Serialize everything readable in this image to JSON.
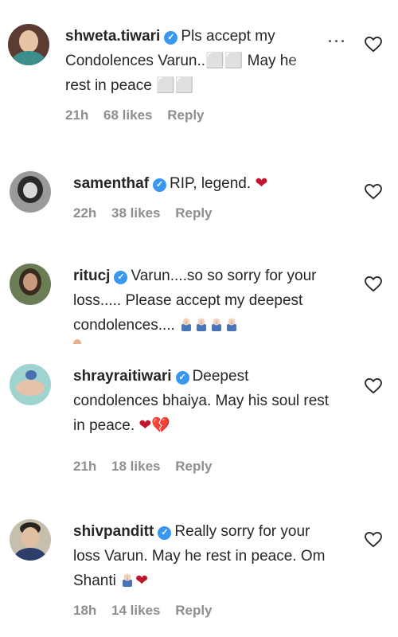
{
  "comments": [
    {
      "username": "shweta.tiwari",
      "text": "Pls accept my Condolences Varun..⬜⬜ May he rest in peace ⬜⬜",
      "time": "21h",
      "likes": "68 likes",
      "reply": "Reply",
      "more": "···"
    },
    {
      "username": "samenthaf",
      "text": "RIP, legend.",
      "emoji": "❤",
      "time": "22h",
      "likes": "38 likes",
      "reply": "Reply"
    },
    {
      "username": "ritucj",
      "text": "Varun....so so sorry for your loss..... Please accept my deepest condolences....",
      "time": "",
      "likes": "",
      "reply": ""
    },
    {
      "username": "shrayraitiwari",
      "text": "Deepest condolences bhaiya. May his soul rest in peace.",
      "emoji": "❤💔",
      "time": "21h",
      "likes": "18 likes",
      "reply": "Reply"
    },
    {
      "username": "shivpanditt",
      "text": "Really sorry for your loss Varun. May he rest in peace. Om Shanti",
      "emoji": "❤",
      "time": "18h",
      "likes": "14 likes",
      "reply": "Reply"
    }
  ],
  "icons": {
    "verified": "✓",
    "heart": "heart-outline-icon",
    "praying": "folded-hands-emoji"
  },
  "colors": {
    "verified": "#3897f0",
    "emoji_heart": "#c0152b",
    "meta": "#8e8e8e"
  }
}
